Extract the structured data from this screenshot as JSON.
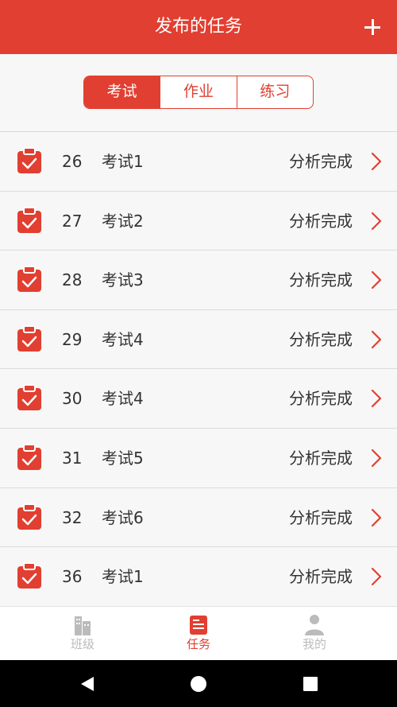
{
  "header": {
    "title": "发布的任务",
    "add_icon": "plus-icon"
  },
  "segment": {
    "tabs": [
      "考试",
      "作业",
      "练习"
    ],
    "active_index": 0
  },
  "tasks": [
    {
      "num": "26",
      "name": "考试1",
      "status": "分析完成"
    },
    {
      "num": "27",
      "name": "考试2",
      "status": "分析完成"
    },
    {
      "num": "28",
      "name": "考试3",
      "status": "分析完成"
    },
    {
      "num": "29",
      "name": "考试4",
      "status": "分析完成"
    },
    {
      "num": "30",
      "name": "考试4",
      "status": "分析完成"
    },
    {
      "num": "31",
      "name": "考试5",
      "status": "分析完成"
    },
    {
      "num": "32",
      "name": "考试6",
      "status": "分析完成"
    },
    {
      "num": "36",
      "name": "考试1",
      "status": "分析完成"
    }
  ],
  "tabbar": {
    "class_label": "班级",
    "task_label": "任务",
    "mine_label": "我的",
    "active": "task"
  },
  "colors": {
    "accent": "#e13f31",
    "inactive": "#bbbbbb"
  }
}
